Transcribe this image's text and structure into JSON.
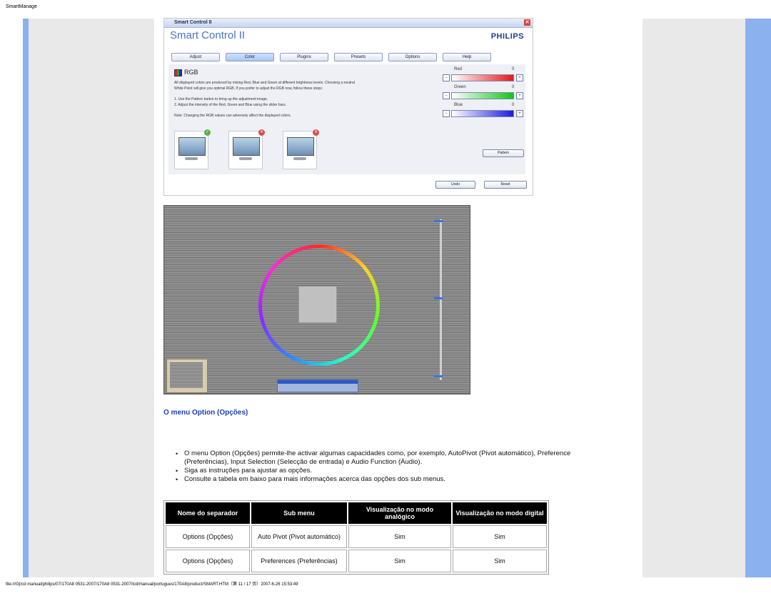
{
  "page": {
    "header": "SmartManage",
    "footer": "file:///G|/cd manual/philips/07/170A8 0531-2007/170A8 0531-2007/lcd/manual/portugues/170A8/product/SMART.HTM（第 11 / 17 页）2007-6-26 15:53:49"
  },
  "smart_control": {
    "window_title": "Smart Control II",
    "heading": "Smart Control II",
    "brand": "PHILIPS",
    "tabs": [
      "Adjust",
      "Color",
      "Plugins",
      "Presets",
      "Options",
      "Help"
    ],
    "active_tab": "Color",
    "section": "RGB",
    "text_lines": [
      "All displayed colors are produced by mixing Red, Blue and Green at different brightness levels. Choosing a neutral",
      "White Point will give you optimal RGB. If you prefer to adjust the RGB now, follow these steps:",
      "1. Use the Pattern button to bring up the adjustment image.",
      "2. Adjust the intensity of the Red, Green and Blue using the slider bars.",
      "Note: Changing the RGB values can adversely affect the displayed colors."
    ],
    "sliders": [
      {
        "label": "Red",
        "value": "0",
        "color": "#e81818"
      },
      {
        "label": "Green",
        "value": "0",
        "color": "#16c41a"
      },
      {
        "label": "Blue",
        "value": "0",
        "color": "#1a1ae0"
      }
    ],
    "thumb_status": [
      "ok",
      "no",
      "no"
    ],
    "buttons": {
      "pattern": "Pattern",
      "undo": "Undo",
      "reset": "Reset"
    }
  },
  "section_title": "O menu Option (Opções)",
  "bullets": [
    "O menu Option (Opções) permite-lhe activar algumas capacidades como, por exemplo, AutoPivot (Pivot automático), Preference (Preferências), Input Selection (Selecção de entrada) e Audio Function (Áudio).",
    "Siga as instruções para ajustar as opções.",
    "Consulte a tabela em baixo para mais informações acerca das opções dos sub menus."
  ],
  "table": {
    "headers": [
      "Nome do separador",
      "Sub menu",
      "Visualização no modo analógico",
      "Visualização no modo digital"
    ],
    "rows": [
      [
        "Options (Opções)",
        "Auto Pivot (Pivot automático)",
        "Sim",
        "Sim"
      ],
      [
        "Options (Opções)",
        "Preferences (Preferências)",
        "Sim",
        "Sim"
      ]
    ]
  }
}
